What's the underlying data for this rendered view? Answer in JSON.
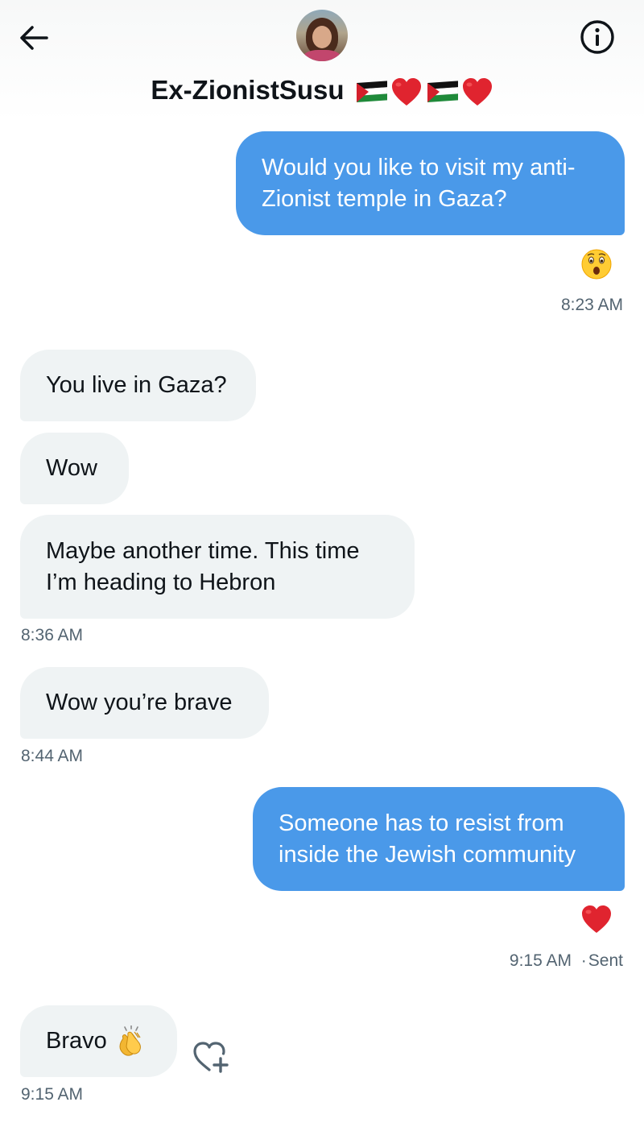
{
  "header": {
    "display_name": "Ex-ZionistSusu",
    "icons": [
      "back-arrow-icon",
      "avatar",
      "info-icon",
      "palestine-flag-emoji",
      "red-heart-emoji"
    ]
  },
  "messages": [
    {
      "direction": "outgoing",
      "text": "Would you like to visit my anti-\nZionist temple in Gaza?",
      "reaction": "astonished-face-emoji"
    },
    {
      "direction": "outgoing",
      "time": "8:23 AM"
    },
    {
      "direction": "incoming",
      "text": "You live in Gaza?"
    },
    {
      "direction": "incoming",
      "text": "Wow"
    },
    {
      "direction": "incoming",
      "text": "Maybe another time. This time\nI’m heading to Hebron",
      "time": "8:36 AM"
    },
    {
      "direction": "incoming",
      "text": "Wow you’re brave",
      "time": "8:44 AM"
    },
    {
      "direction": "outgoing",
      "text": "Someone has to resist from\ninside the Jewish community",
      "reaction": "red-heart-emoji",
      "time": "9:15 AM",
      "status": "Sent"
    },
    {
      "direction": "incoming",
      "text": "Bravo",
      "emoji": "clapping-hands-emoji",
      "time": "9:15 AM"
    }
  ],
  "timestamps": {
    "m1": "8:23 AM",
    "m5": "8:36 AM",
    "m6": "8:44 AM",
    "m7": "9:15 AM",
    "m7_separator": "·",
    "m7_status": "Sent",
    "m8": "9:15 AM"
  },
  "colors": {
    "outgoing_bubble": "#4a99e9",
    "incoming_bubble": "#eff3f4",
    "meta_text": "#536471",
    "text": "#0f1419"
  }
}
